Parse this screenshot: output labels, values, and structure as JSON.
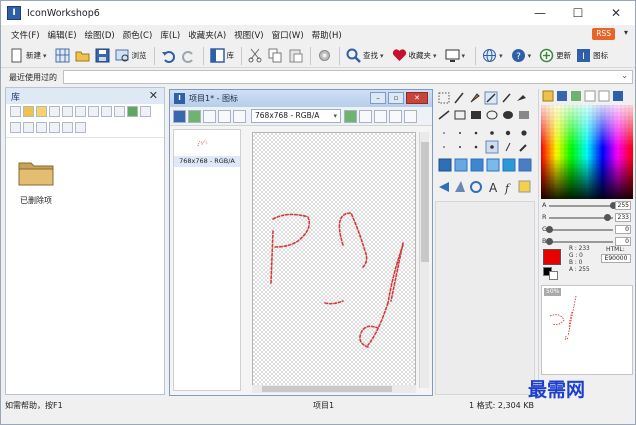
{
  "app": {
    "title": "IconWorkshop6"
  },
  "window_controls": {
    "minimize": "—",
    "maximize": "☐",
    "close": "✕"
  },
  "menu": [
    "文件(F)",
    "编辑(E)",
    "绘图(D)",
    "颜色(C)",
    "库(L)",
    "收藏夹(A)",
    "视图(V)",
    "窗口(W)",
    "帮助(H)"
  ],
  "rss_badge": "RSS",
  "toolbar": {
    "new_label": "新建",
    "browse_label": "浏览",
    "library_label": "库",
    "find_label": "查找",
    "favorites_label": "收藏夹",
    "update_label": "更新",
    "icon_label": "图标"
  },
  "recent": {
    "label": "最近使用过的"
  },
  "library": {
    "title": "库",
    "close": "✕",
    "folder_label": "已删除项"
  },
  "project": {
    "title": "项目1* - 图标",
    "format_select": "768x768 - RGB/A",
    "format_item": "768x768 - RGB/A"
  },
  "colors": {
    "sliders": [
      {
        "label": "A",
        "value": "255",
        "level": 1.0
      },
      {
        "label": "R",
        "value": "233",
        "level": 0.914
      },
      {
        "label": "G",
        "value": "0",
        "level": 0.0
      },
      {
        "label": "B",
        "value": "0",
        "level": 0.0
      }
    ],
    "rgba_lines": [
      "R : 233",
      "G : 0",
      "B : 0",
      "A : 255"
    ],
    "html_label": "HTML:",
    "html_value": "E90000",
    "primary": "#e90000",
    "zoom_badge": "50%"
  },
  "status": {
    "left": "如需帮助，按F1",
    "middle": "项目1",
    "right": "1 格式:  2,304 KB"
  },
  "watermark": "最需网"
}
